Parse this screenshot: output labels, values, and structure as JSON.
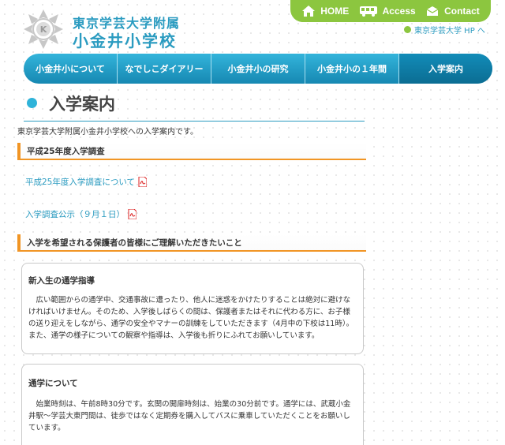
{
  "header": {
    "school_name_top": "東京学芸大学附属",
    "school_name_bottom": "小金井小学校",
    "top_links": [
      {
        "label": "HOME",
        "icon": "home-icon"
      },
      {
        "label": "Access",
        "icon": "bus-icon"
      },
      {
        "label": "Contact",
        "icon": "mail-icon"
      }
    ],
    "gakugei_link": "東京学芸大学 HP へ"
  },
  "nav": {
    "items": [
      "小金井小について",
      "なでしこダイアリー",
      "小金井小の研究",
      "小金井小の１年間",
      "入学案内"
    ],
    "active_index": 4
  },
  "page": {
    "title": "入学案内",
    "intro": "東京学芸大学附属小金井小学校への入学案内です。"
  },
  "sections": [
    {
      "heading": "平成25年度入学調査",
      "links": [
        "平成25年度入学調査について",
        "入学調査公示（９月１日）"
      ]
    },
    {
      "heading": "入学を希望される保護者の皆様にご理解いただきたいこと"
    }
  ],
  "cards": [
    {
      "title": "新入生の通学指導",
      "text": "広い範囲からの通学中、交通事故に遭ったり、他人に迷惑をかけたりすることは絶対に避けなければいけません。そのため、入学後しばらくの間は、保護者またはそれに代わる方に、お子様の送り迎えをしながら、通学の安全やマナーの訓練をしていただきます（4月中の下校は11時）。また、通学の様子についての観察や指導は、入学後も折りにふれてお願いしています。"
    },
    {
      "title": "通学について",
      "text": "始業時刻は、午前8時30分です。玄関の開扉時刻は、始業の30分前です。通学には、武蔵小金井駅～学芸大東門間は、徒歩ではなく定期券を購入してバスに乗車していただくことをお願いしています。"
    }
  ],
  "colors": {
    "accent_blue": "#2a9bc0",
    "green": "#8cc63f",
    "orange": "#f19524"
  }
}
